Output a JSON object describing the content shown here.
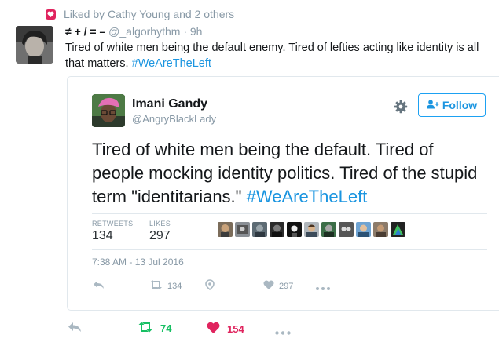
{
  "activity": {
    "liked_by": "Liked by Cathy Young and 2 others"
  },
  "tweet": {
    "name": "≠ + / = –",
    "handle": "@_algorhythm",
    "time": "9h",
    "text": "Tired of white men being the default enemy. Tired of lefties acting like identity is all that matters.",
    "hashtag": "#WeAreTheLeft",
    "actions": {
      "retweets": "74",
      "likes": "154"
    }
  },
  "quoted": {
    "name": "Imani Gandy",
    "handle": "@AngryBlackLady",
    "follow_label": "Follow",
    "text": "Tired of white men being the default. Tired of people mocking identity politics. Tired of the stupid term \"identitarians.\"",
    "hashtag": "#WeAreTheLeft",
    "stats": {
      "retweets_label": "RETWEETS",
      "retweets": "134",
      "likes_label": "LIKES",
      "likes": "297"
    },
    "date": "7:38 AM - 13 Jul 2016",
    "actions": {
      "retweets": "134",
      "likes": "297"
    }
  },
  "colors": {
    "link": "#1b95e0",
    "retweet_active": "#17bf63",
    "like_active": "#e0245e",
    "muted": "#8899a6"
  },
  "icons": [
    "heart-icon",
    "gear-icon",
    "follow-person-icon",
    "reply-icon",
    "retweet-icon",
    "like-icon",
    "more-icon",
    "periscope-icon"
  ]
}
